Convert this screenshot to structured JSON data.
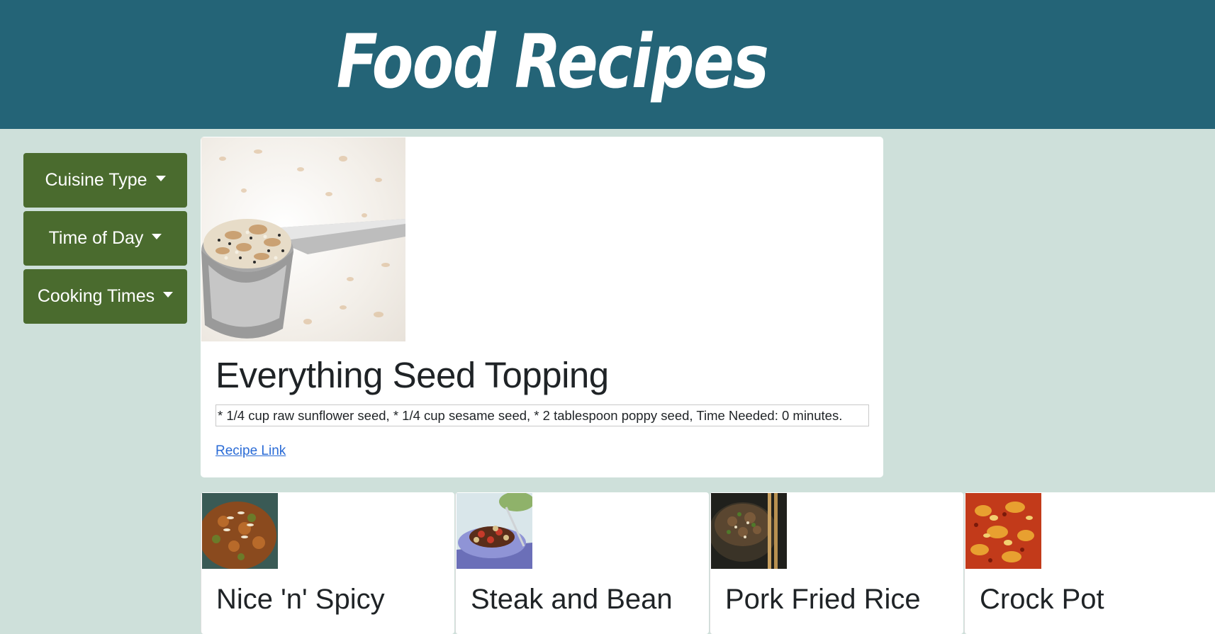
{
  "header": {
    "title": "Food Recipes"
  },
  "sidebar": {
    "filters": [
      {
        "label": "Cuisine Type"
      },
      {
        "label": "Time of Day"
      },
      {
        "label": "Cooking Times"
      }
    ]
  },
  "featured": {
    "image": "everything-seed-topping-photo",
    "title": "Everything Seed Topping",
    "description": "* 1/4 cup raw sunflower seed, * 1/4 cup sesame seed, * 2 tablespoon poppy seed, Time Needed: 0 minutes.",
    "link_label": "Recipe Link"
  },
  "cards": [
    {
      "title": "Nice 'n' Spicy",
      "image": "spicy-dish-photo"
    },
    {
      "title": "Steak and Bean",
      "image": "steak-bean-plate-photo"
    },
    {
      "title": "Pork Fried Rice",
      "image": "pork-fried-rice-photo"
    },
    {
      "title": "Crock Pot",
      "image": "crock-pot-dish-photo"
    }
  ],
  "colors": {
    "header_bg": "#246477",
    "page_bg": "#cee0da",
    "button_bg": "#4a6b2e",
    "link": "#2a6bd6"
  }
}
